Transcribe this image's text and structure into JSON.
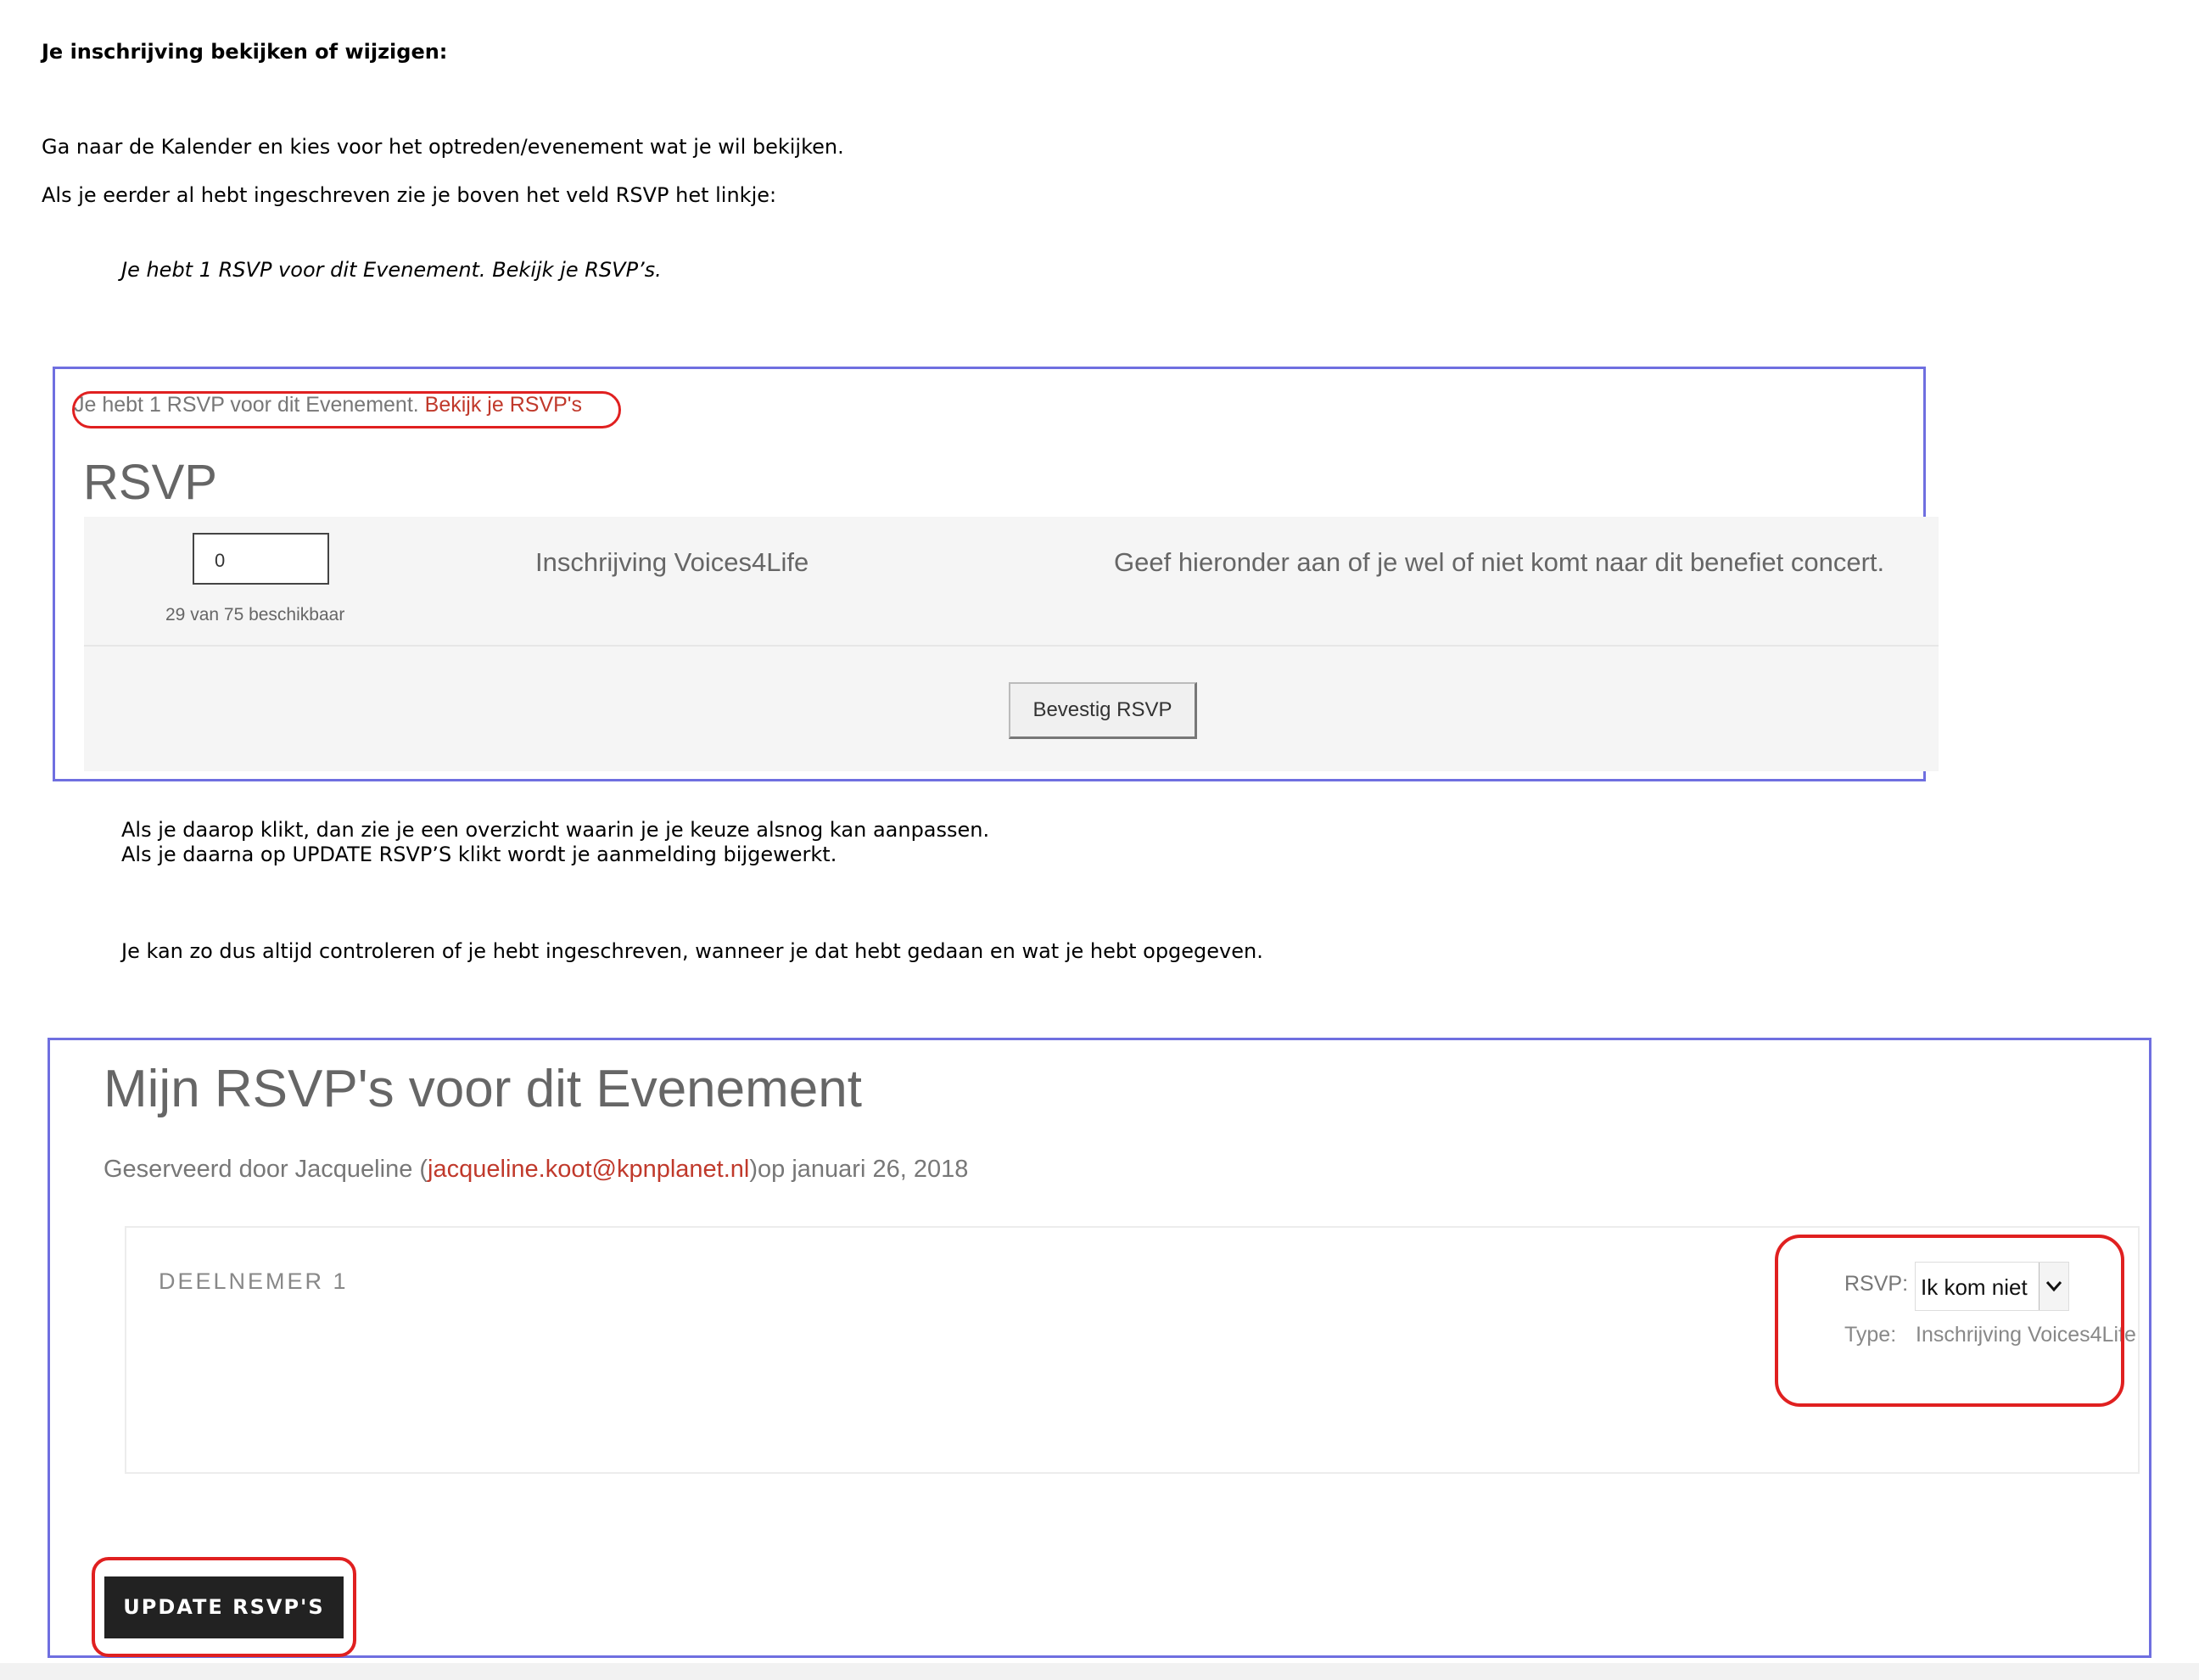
{
  "doc": {
    "heading": "Je inschrijving bekijken of wijzigen:",
    "intro1": "Ga naar de Kalender en kies voor het optreden/evenement wat je wil bekijken.",
    "intro2": "Als je eerder al hebt ingeschreven zie je boven het veld RSVP het linkje:",
    "quote": "Je hebt 1 RSVP voor dit Evenement. Bekijk je RSVP’s.",
    "after1": "Als je daarop klikt, dan zie je een overzicht waarin je je keuze alsnog kan aanpassen.",
    "after2": "Als je daarna op UPDATE RSVP’S klikt wordt je aanmelding bijgewerkt.",
    "after3": "Je kan zo dus altijd controleren of je hebt ingeschreven, wanneer je dat hebt gedaan en wat je hebt opgegeven."
  },
  "shot1": {
    "notice_text": "Je hebt 1 RSVP voor dit Evenement.",
    "notice_link": "Bekijk je RSVP's",
    "title": "RSVP",
    "quantity_value": "0",
    "availability": "29 van 75 beschikbaar",
    "ticket_name": "Inschrijving Voices4Life",
    "ticket_description": "Geef hieronder aan of je wel of niet komt naar dit benefiet concert.",
    "confirm_button": "Bevestig RSVP"
  },
  "shot2": {
    "title": "Mijn RSVP's voor dit Evenement",
    "reserved_prefix": "Geserveerd door Jacqueline (",
    "reserved_email": "jacqueline.koot@kpnplanet.nl",
    "reserved_suffix": ")op januari 26, 2018",
    "attendee_label": "DEELNEMER 1",
    "rsvp_label": "RSVP:",
    "rsvp_selected": "Ik kom niet",
    "type_label": "Type:",
    "type_value": "Inschrijving Voices4Life",
    "update_button": "UPDATE RSVP'S"
  },
  "icons": {
    "dropdown": "chevron-down-icon"
  },
  "colors": {
    "annotation_red": "#e02020",
    "frame_blue": "#6f6fe0",
    "link_red": "#c0392b",
    "button_dark": "#222222"
  }
}
